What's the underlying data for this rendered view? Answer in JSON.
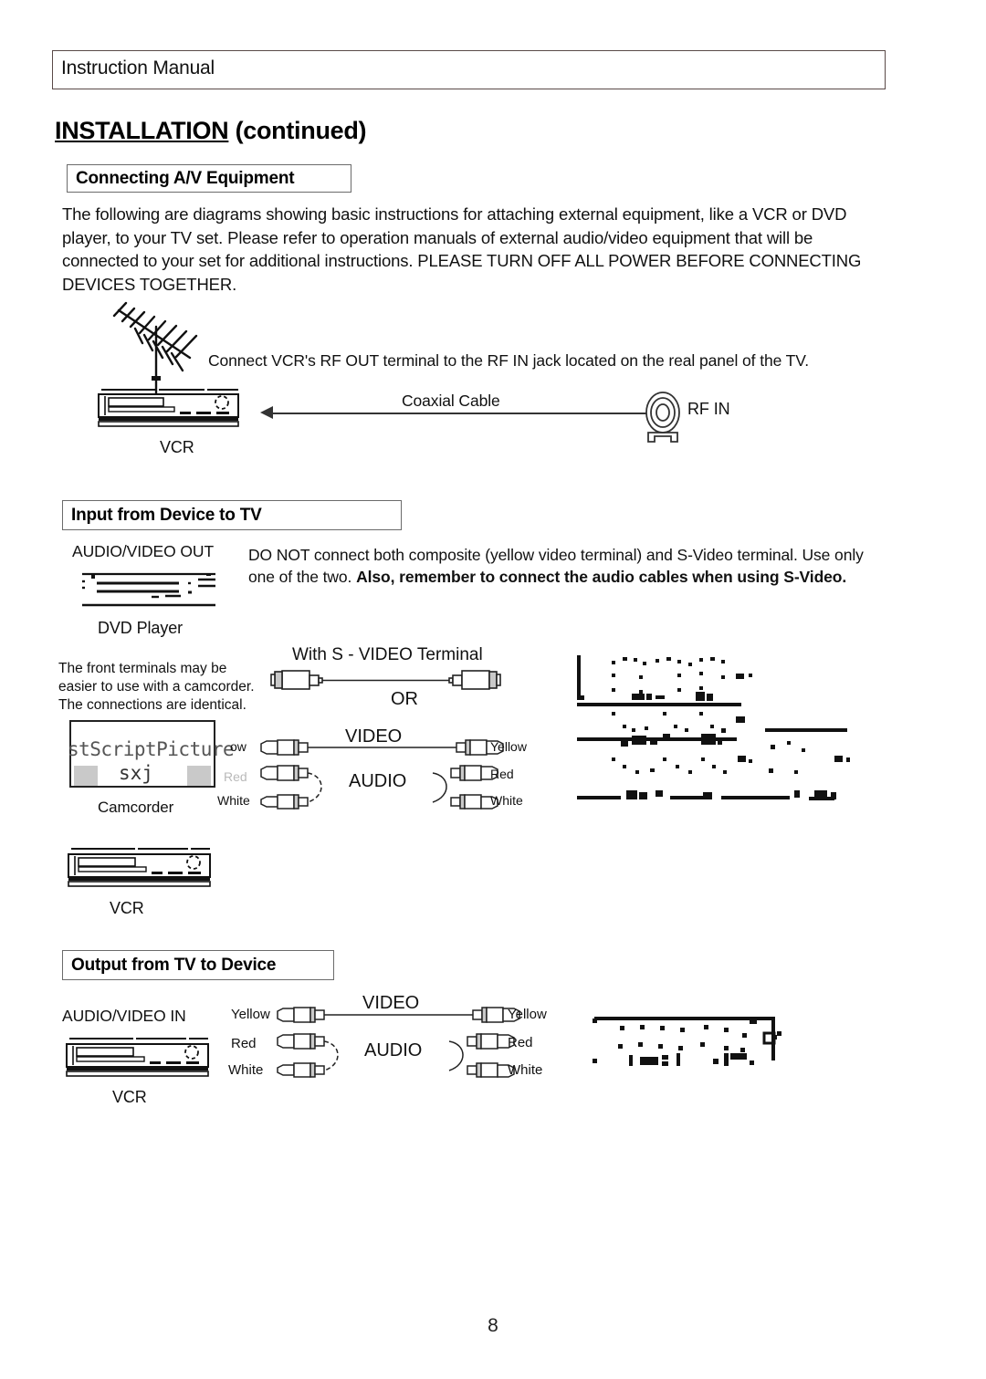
{
  "header": {
    "title": "Instruction Manual"
  },
  "page": {
    "title_underlined": "INSTALLATION",
    "title_rest": " (continued)",
    "number": "8"
  },
  "sections": {
    "connecting": {
      "heading": "Connecting A/V Equipment",
      "body": "The following are diagrams showing basic instructions for attaching external equipment, like a VCR or DVD player, to your TV set. Please refer to operation manuals of external audio/video equipment that will be connected to your set for additional instructions. PLEASE TURN OFF ALL POWER BEFORE CONNECTING DEVICES TOGETHER.",
      "diagram": {
        "instruction": "Connect VCR's RF OUT terminal to the RF IN jack located on the real panel of the TV.",
        "cable_label": "Coaxial Cable",
        "jack_label": "RF IN",
        "device_label": "VCR"
      }
    },
    "input": {
      "heading": "Input from Device to TV",
      "device_port_label": "AUDIO/VIDEO OUT",
      "device_label": "DVD Player",
      "warning_plain_1": "DO NOT connect both composite (yellow video terminal) and S-Video terminal.  Use only one of the two.  ",
      "warning_bold": "Also, remember to connect the audio cables when using S-Video.",
      "camcorder_note": "The front terminals may be easier to use with a camcorder. The connections are identical.",
      "svideo_label": "With S - VIDEO Terminal",
      "or_label": "OR",
      "video_label": "VIDEO",
      "audio_label": "AUDIO",
      "camcorder_label": "Camcorder",
      "camcorder_artifact_line1": "stScriptPicture",
      "camcorder_artifact_line2": "sxj",
      "left_plug_labels": [
        "ow",
        "Red",
        "White"
      ],
      "right_plug_labels": [
        "Yellow",
        "Red",
        "White"
      ],
      "vcr_label": "VCR"
    },
    "output": {
      "heading": "Output from TV to Device",
      "device_port_label": "AUDIO/VIDEO IN",
      "device_label": "VCR",
      "video_label": "VIDEO",
      "audio_label": "AUDIO",
      "left_plug_labels": [
        "Yellow",
        "Red",
        "White"
      ],
      "right_plug_labels": [
        "Yellow",
        "Red",
        "White"
      ]
    }
  },
  "colors": {
    "ink": "#111111",
    "rule": "#5a4a48",
    "box_border": "#6b6b6b",
    "plug_gray": "#c9c9c9"
  }
}
